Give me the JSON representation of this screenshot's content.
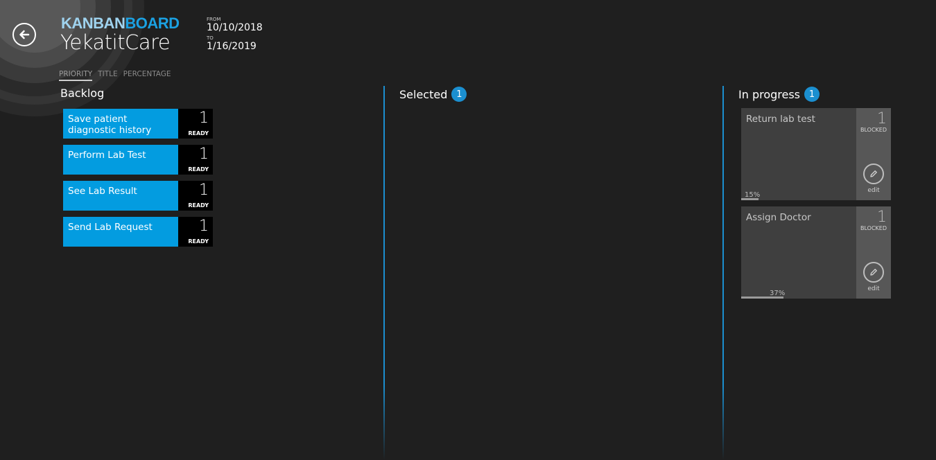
{
  "header": {
    "brand_part1": "KANBAN",
    "brand_part2": "BOARD",
    "project_name": "YekatitCare",
    "from_label": "FROM",
    "from_date": "10/10/2018",
    "to_label": "TO",
    "to_date": "1/16/2019"
  },
  "sort_tabs": [
    "PRIORITY",
    "TITLE",
    "PERCENTAGE"
  ],
  "active_sort": "PRIORITY",
  "columns": {
    "backlog": {
      "title": "Backlog",
      "cards": [
        {
          "title": "Save patient diagnostic history",
          "count": "1",
          "state": "READY"
        },
        {
          "title": "Perform Lab Test",
          "count": "1",
          "state": "READY"
        },
        {
          "title": "See Lab Result",
          "count": "1",
          "state": "READY"
        },
        {
          "title": "Send Lab Request",
          "count": "1",
          "state": "READY"
        }
      ]
    },
    "selected": {
      "title": "Selected",
      "badge": "1"
    },
    "in_progress": {
      "title": "In progress",
      "badge": "1",
      "cards": [
        {
          "title": "Return lab test",
          "count": "1",
          "state": "BLOCKED",
          "edit_label": "edit",
          "progress_text": "15%",
          "progress": 0.15
        },
        {
          "title": "Assign Doctor",
          "count": "1",
          "state": "BLOCKED",
          "edit_label": "edit",
          "progress_text": "37%",
          "progress": 0.37
        }
      ]
    }
  },
  "colors": {
    "background": "#1f1f1f",
    "accent": "#1ba1e2",
    "card_ready": "#039ce0",
    "card_blocked": "#3f3f3f"
  },
  "icons": [
    "back-arrow-icon",
    "pencil-icon"
  ]
}
